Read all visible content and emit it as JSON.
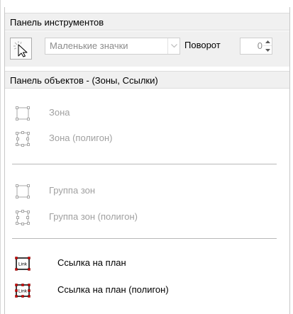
{
  "toolbar_panel": {
    "title": "Панель инструментов",
    "view_mode": "Маленькие значки",
    "rotation_label": "Поворот",
    "rotation_value": "0"
  },
  "objects_panel": {
    "title": "Панель объектов - (Зоны, Ссылки)",
    "items": [
      {
        "label": "Зона",
        "enabled": false,
        "icon": "zone-rectangle-icon"
      },
      {
        "label": "Зона (полигон)",
        "enabled": false,
        "icon": "zone-polygon-icon"
      },
      {
        "label": "Группа зон",
        "enabled": false,
        "icon": "zone-group-rectangle-icon"
      },
      {
        "label": "Группа зон (полигон)",
        "enabled": false,
        "icon": "zone-group-polygon-icon"
      },
      {
        "label": "Ссылка на план",
        "enabled": true,
        "icon": "plan-link-icon"
      },
      {
        "label": "Ссылка на план (полигон)",
        "enabled": true,
        "icon": "plan-link-polygon-icon"
      }
    ],
    "icon_text": "Link"
  },
  "colors": {
    "panel_bg": "#f0f0f0",
    "disabled_text": "#a0a0a0",
    "handle_red": "#d40000"
  }
}
